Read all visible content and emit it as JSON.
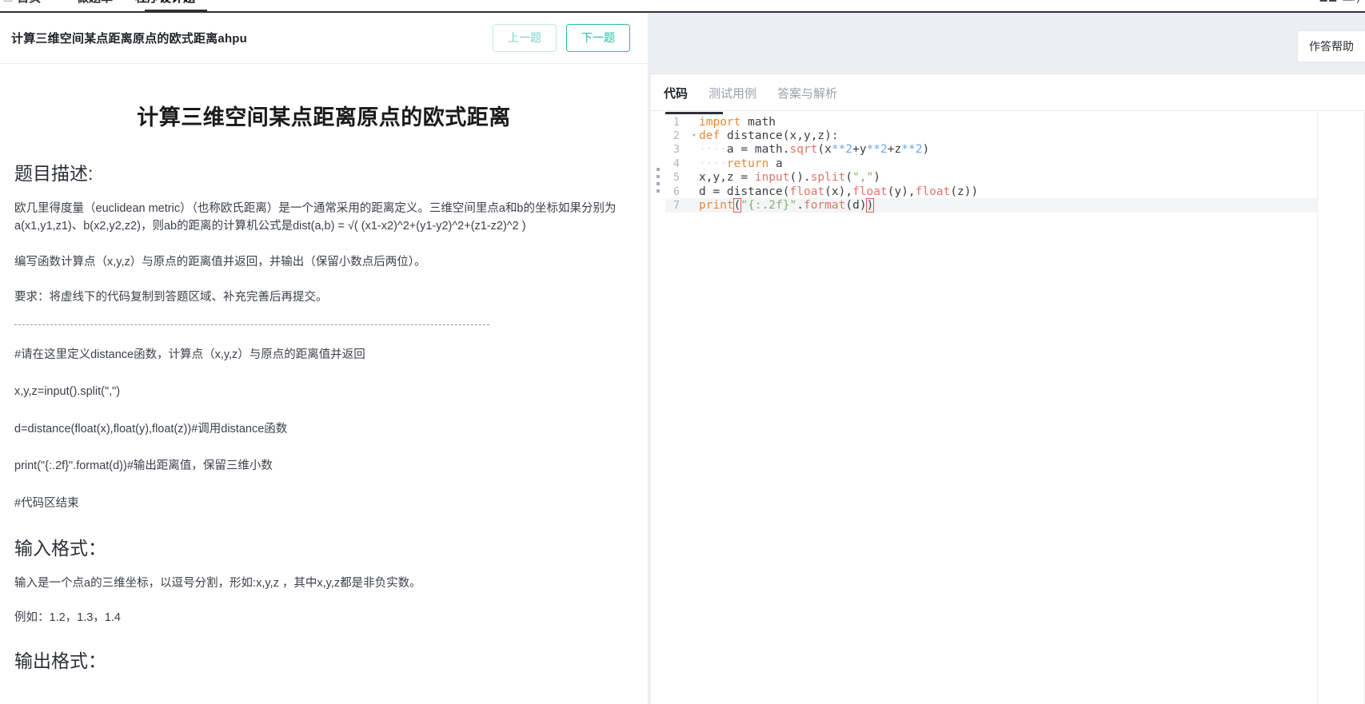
{
  "top_nav": {
    "items": [
      {
        "icon": "book-icon",
        "label": "首页",
        "active": false
      },
      {
        "icon": "star-icon",
        "label": "做题单",
        "active": false
      },
      {
        "icon": "",
        "label": "程序设计题",
        "active": true
      }
    ],
    "right": {
      "icon": "user-icon",
      "label": "二/)"
    }
  },
  "question": {
    "title": "计算三维空间某点距离原点的欧式距离ahpu",
    "prev_label": "上一题",
    "next_label": "下一题",
    "doc_title": "计算三维空间某点距离原点的欧式距离",
    "desc_heading": "题目描述:",
    "desc_paragraphs": [
      "欧几里得度量（euclidean metric）（也称欧氏距离）是一个通常采用的距离定义。三维空间里点a和b的坐标如果分别为a(x1,y1,z1)、b(x2,y2,z2)，则ab的距离的计算机公式是dist(a,b) = √( (x1-x2)^2+(y1-y2)^2+(z1-z2)^2 )",
      "编写函数计算点（x,y,z）与原点的距离值并返回，并输出（保留小数点后两位）。",
      "要求：将虚线下的代码复制到答题区域、补充完善后再提交。"
    ],
    "template_lines": [
      "#请在这里定义distance函数，计算点（x,y,z）与原点的距离值并返回",
      " x,y,z=input().split(\",\")",
      "d=distance(float(x),float(y),float(z))#调用distance函数",
      "print(\"{:.2f}\".format(d))#输出距离值，保留三维小数",
      "#代码区结束"
    ],
    "input_heading": "输入格式：",
    "input_desc": "输入是一个点a的三维坐标，以逗号分割，形如:x,y,z ，其中x,y,z都是非负实数。",
    "input_example": "例如：1.2，1.3，1.4",
    "output_heading": "输出格式："
  },
  "editor": {
    "help_label": "作答帮助",
    "tabs": [
      {
        "label": "代码",
        "active": true
      },
      {
        "label": "测试用例",
        "active": false
      },
      {
        "label": "答案与解析",
        "active": false
      }
    ],
    "code_lines": [
      {
        "num": "1",
        "fold": "",
        "current": false,
        "tokens": [
          {
            "t": "import",
            "c": "tok-kw"
          },
          {
            "t": " math",
            "c": "tok-plain"
          }
        ]
      },
      {
        "num": "2",
        "fold": "▾",
        "current": false,
        "tokens": [
          {
            "t": "def",
            "c": "tok-kw"
          },
          {
            "t": " ",
            "c": "tok-plain"
          },
          {
            "t": "distance",
            "c": "tok-plain"
          },
          {
            "t": "(x,y,z):",
            "c": "tok-plain"
          }
        ]
      },
      {
        "num": "3",
        "fold": "",
        "current": false,
        "tokens": [
          {
            "t": "····",
            "c": "tok-ind"
          },
          {
            "t": "a = math.",
            "c": "tok-plain"
          },
          {
            "t": "sqrt",
            "c": "tok-fn"
          },
          {
            "t": "(x",
            "c": "tok-plain"
          },
          {
            "t": "**2",
            "c": "tok-num"
          },
          {
            "t": "+y",
            "c": "tok-plain"
          },
          {
            "t": "**2",
            "c": "tok-num"
          },
          {
            "t": "+z",
            "c": "tok-plain"
          },
          {
            "t": "**2",
            "c": "tok-num"
          },
          {
            "t": ")",
            "c": "tok-plain"
          }
        ]
      },
      {
        "num": "4",
        "fold": "",
        "current": false,
        "tokens": [
          {
            "t": "····",
            "c": "tok-ind"
          },
          {
            "t": "return",
            "c": "tok-kw"
          },
          {
            "t": " a",
            "c": "tok-plain"
          }
        ]
      },
      {
        "num": "5",
        "fold": "",
        "current": false,
        "tokens": [
          {
            "t": "x,y,z = ",
            "c": "tok-plain"
          },
          {
            "t": "input",
            "c": "tok-fn"
          },
          {
            "t": "().",
            "c": "tok-plain"
          },
          {
            "t": "split",
            "c": "tok-fn"
          },
          {
            "t": "(",
            "c": "tok-plain"
          },
          {
            "t": "\",\"",
            "c": "tok-str"
          },
          {
            "t": ")",
            "c": "tok-plain"
          }
        ]
      },
      {
        "num": "6",
        "fold": "",
        "current": false,
        "tokens": [
          {
            "t": "d = distance(",
            "c": "tok-plain"
          },
          {
            "t": "float",
            "c": "tok-fn"
          },
          {
            "t": "(x),",
            "c": "tok-plain"
          },
          {
            "t": "float",
            "c": "tok-fn"
          },
          {
            "t": "(y),",
            "c": "tok-plain"
          },
          {
            "t": "float",
            "c": "tok-fn"
          },
          {
            "t": "(z))",
            "c": "tok-plain"
          }
        ]
      },
      {
        "num": "7",
        "fold": "",
        "current": true,
        "tokens": [
          {
            "t": "print",
            "c": "tok-kw"
          },
          {
            "t": "(",
            "c": "tok-plain brk"
          },
          {
            "t": "\"{:.2f}\"",
            "c": "tok-str"
          },
          {
            "t": ".",
            "c": "tok-plain"
          },
          {
            "t": "format",
            "c": "tok-fn"
          },
          {
            "t": "(d)",
            "c": "tok-plain"
          },
          {
            "t": ")",
            "c": "tok-plain brk"
          }
        ]
      }
    ]
  },
  "colors": {
    "accent": "#25bfa6",
    "accent_light": "#7fd3c6",
    "editor_bg": "#eceef2",
    "text": "#3b3f45"
  }
}
